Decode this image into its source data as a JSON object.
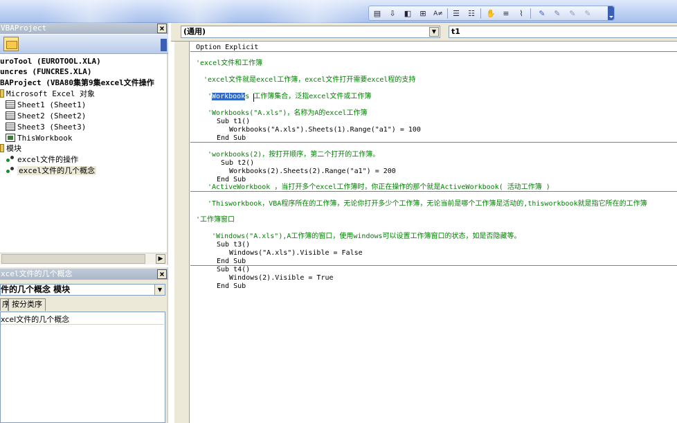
{
  "toolbar": {
    "icons": [
      "indent-icon",
      "outdent-icon",
      "breakpoint-icon",
      "quick-info-icon",
      "complete-word-icon",
      "param-info-icon",
      "comment-block-icon",
      "uncomment-block-icon",
      "hand-icon",
      "bookmark-icon",
      "next-bookmark-icon",
      "prev-bookmark-icon",
      "clear-bookmarks-icon"
    ]
  },
  "project": {
    "title": "VBAProject",
    "tree": [
      {
        "label": "uroTool (EUROTOOL.XLA)",
        "bold": true
      },
      {
        "label": "uncres (FUNCRES.XLA)",
        "bold": true
      },
      {
        "label": "BAProject (VBA80集第9集excel文件操作",
        "bold": true
      },
      {
        "label": "Microsoft Excel 对象"
      },
      {
        "label": "Sheet1 (Sheet1)"
      },
      {
        "label": "Sheet2 (Sheet2)"
      },
      {
        "label": "Sheet3 (Sheet3)"
      },
      {
        "label": "ThisWorkbook"
      },
      {
        "label": "模块"
      },
      {
        "label": "excel文件的操作"
      },
      {
        "label": "excel文件的几个概念"
      }
    ]
  },
  "properties": {
    "title": "xcel文件的几个概念",
    "selector_value": "件的几个概念  模块",
    "tab_alpha": "序",
    "tab_category": "按分类序",
    "name_value": "xcel文件的几个概念"
  },
  "code": {
    "object_combo": "(通用)",
    "procedure_combo": "t1",
    "lines": [
      {
        "text": "Option Explicit",
        "cls": ""
      },
      {
        "text": "'excel文件和工作簿",
        "cls": "comment"
      },
      {
        "text": "'excel文件就是excel工作簿，excel文件打开需要excel程的支持",
        "cls": "comment"
      },
      {
        "text_pre": "'",
        "text_sel": "Workbook",
        "text_post": "s 工作簿集合，泛指excel文件或工作簿",
        "cls": "comment"
      },
      {
        "text": "'Workbooks(\"A.xls\")，名称为A的excel工作簿",
        "cls": "comment"
      },
      {
        "text": "Sub t1()",
        "cls": ""
      },
      {
        "text": "Workbooks(\"A.xls\").Sheets(1).Range(\"a1\") = 100",
        "cls": ""
      },
      {
        "text": "End Sub",
        "cls": ""
      },
      {
        "text": "'workbooks(2)，按打开顺序，第二个打开的工作簿。",
        "cls": "comment"
      },
      {
        "text": "Sub t2()",
        "cls": ""
      },
      {
        "text": "Workbooks(2).Sheets(2).Range(\"a1\") = 200",
        "cls": ""
      },
      {
        "text": "End Sub",
        "cls": ""
      },
      {
        "text": "'ActiveWorkbook ，当打开多个excel工作簿时，你正在操作的那个就是ActiveWorkbook( 活动工作簿 )",
        "cls": "comment"
      },
      {
        "text": "'Thisworkbook，VBA程序所在的工作簿，无论你打开多少个工作簿，无论当前是哪个工作簿是活动的,thisworkbook就是指它所在的工作簿",
        "cls": "comment"
      },
      {
        "text": "'工作簿窗口",
        "cls": "comment"
      },
      {
        "text": "'Windows(\"A.xls\"),A工作簿的窗口，使用windows可以设置工作簿窗口的状态，如是否隐藏等。",
        "cls": "comment"
      },
      {
        "text": "Sub t3()",
        "cls": ""
      },
      {
        "text": "Windows(\"A.xls\").Visible = False",
        "cls": ""
      },
      {
        "text": "End Sub",
        "cls": ""
      },
      {
        "text": "Sub t4()",
        "cls": ""
      },
      {
        "text": "Windows(2).Visible = True",
        "cls": ""
      },
      {
        "text": "End Sub",
        "cls": ""
      }
    ]
  }
}
